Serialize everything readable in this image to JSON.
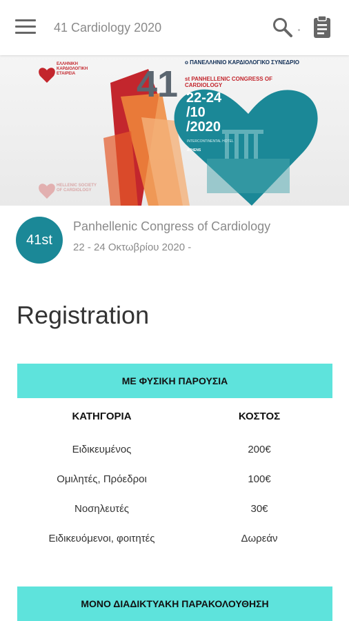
{
  "appbar": {
    "title": "41 Cardiology 2020",
    "menu_icon": "menu-icon",
    "search_icon": "search-icon",
    "clipboard_icon": "clipboard-icon"
  },
  "banner": {
    "society_gr": "ΕΛΛΗΝΙΚΗ ΚΑΡΔΙΟΛΟΓΙΚΗ ΕΤΑΙΡΕΙΑ",
    "number": "41",
    "congress_gr": "ο ΠΑΝΕΛΛΗΝΙΟ ΚΑΡΔΙΟΛΟΓΙΚΟ ΣΥΝΕΔΡΙΟ",
    "congress_en": "st PANHELLENIC CONGRESS OF CARDIOLOGY",
    "dates_line1": "22-24",
    "dates_line2": "/10",
    "dates_line3": "/2020",
    "venue": "INTERCONTINENTAL HOTEL",
    "city": "ATHENS",
    "society_en": "HELLENIC SOCIETY OF CARDIOLOGY",
    "colors": {
      "heart": "#1b8897",
      "red": "#c3262d",
      "orange": "#f08a3c",
      "navy": "#0d2b53"
    }
  },
  "event": {
    "badge": "41st",
    "title": "Panhellenic Congress of Cardiology",
    "dates": "22 - 24 Οκτωβρίου 2020 -",
    "badge_color": "#1b8897"
  },
  "registration": {
    "heading": "Registration",
    "in_person_label": "ΜΕ ΦΥΣΙΚΗ ΠΑΡΟΥΣΙΑ",
    "online_label": "ΜΟΝΟ ΔΙΑΔΙΚΤΥΑΚΗ ΠΑΡΑΚΟΛΟΥΘΗΣΗ",
    "pill_color": "#5ee3dc",
    "columns": [
      "ΚΑΤΗΓΟΡΙΑ",
      "ΚΟΣΤΟΣ"
    ],
    "rows": [
      {
        "category": "Ειδικευμένος",
        "cost": "200€"
      },
      {
        "category": "Ομιλητές, Πρόεδροι",
        "cost": "100€"
      },
      {
        "category": "Νοσηλευτές",
        "cost": "30€"
      },
      {
        "category": "Ειδικευόμενοι, φοιτητές",
        "cost": "Δωρεάν"
      }
    ]
  }
}
